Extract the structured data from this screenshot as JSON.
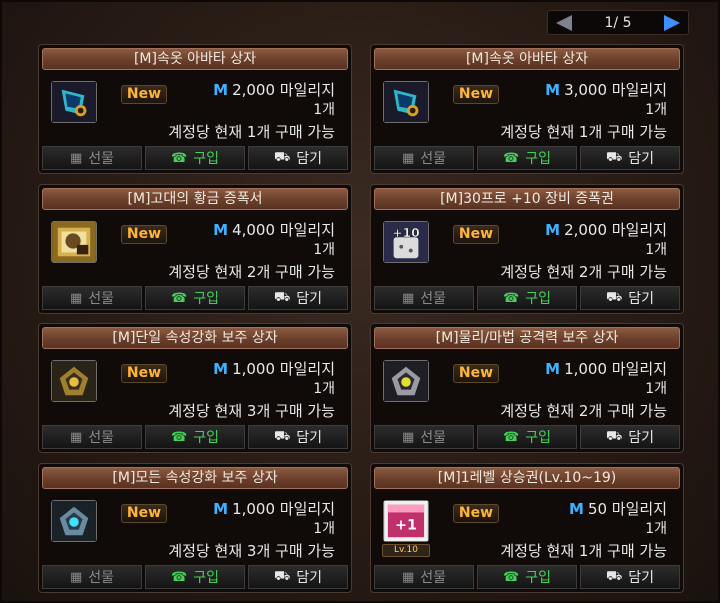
{
  "pager": {
    "current": "1",
    "total": "5",
    "label": "1/ 5"
  },
  "buttons": {
    "gift": "선물",
    "buy": "구입",
    "cart": "담기"
  },
  "new_badge": "New",
  "items": [
    {
      "title": "[M]속옷 아바타 상자",
      "price": "2,000 마일리지",
      "qty": "1개",
      "limit": "계정당 현재 1개 구매 가능",
      "icon": "underwear-box-icon"
    },
    {
      "title": "[M]속옷 아바타 상자",
      "price": "3,000 마일리지",
      "qty": "1개",
      "limit": "계정당 현재 1개 구매 가능",
      "icon": "underwear-box-icon"
    },
    {
      "title": "[M]고대의 황금 증폭서",
      "price": "4,000 마일리지",
      "qty": "1개",
      "limit": "계정당 현재 2개 구매 가능",
      "icon": "golden-scroll-icon"
    },
    {
      "title": "[M]30프로 +10 장비 증폭권",
      "price": "2,000 마일리지",
      "qty": "1개",
      "limit": "계정당 현재 2개 구매 가능",
      "icon": "plus10-ticket-icon"
    },
    {
      "title": "[M]단일 속성강화 보주 상자",
      "price": "1,000 마일리지",
      "qty": "1개",
      "limit": "계정당 현재 3개 구매 가능",
      "icon": "orb-box-gold-icon"
    },
    {
      "title": "[M]물리/마법 공격력 보주 상자",
      "price": "1,000 마일리지",
      "qty": "1개",
      "limit": "계정당 현재 2개 구매 가능",
      "icon": "orb-box-silver-icon"
    },
    {
      "title": "[M]모든 속성강화 보주 상자",
      "price": "1,000 마일리지",
      "qty": "1개",
      "limit": "계정당 현재 3개 구매 가능",
      "icon": "orb-box-blue-icon"
    },
    {
      "title": "[M]1레벨 상승권(Lv.10~19)",
      "price": "50 마일리지",
      "qty": "1개",
      "limit": "계정당 현재 1개 구매 가능",
      "icon": "level-up-ticket-icon",
      "lv_tag": "Lv.10"
    }
  ],
  "colors": {
    "mileage_m": "#3fb2ff",
    "new_badge": "#ffb43a",
    "buy": "#46d05a",
    "title_bar": "#6a3f2b"
  }
}
